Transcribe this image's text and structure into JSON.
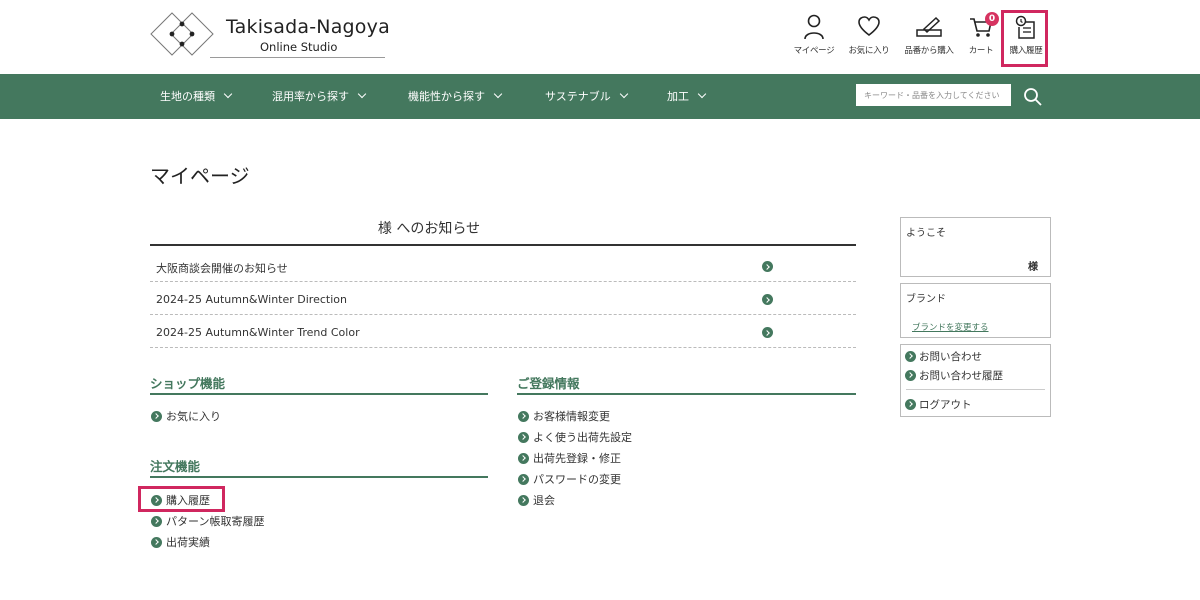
{
  "header": {
    "logo_title": "Takisada-Nagoya",
    "logo_subtitle": "Online Studio",
    "utility": [
      {
        "label": "マイページ",
        "icon": "person-icon"
      },
      {
        "label": "お気に入り",
        "icon": "heart-icon"
      },
      {
        "label": "品番から購入",
        "icon": "pencil-icon"
      },
      {
        "label": "カート",
        "icon": "cart-icon"
      },
      {
        "label": "購入履歴",
        "icon": "history-icon"
      }
    ],
    "cart_count": "0"
  },
  "nav": {
    "items": [
      {
        "label": "生地の種類"
      },
      {
        "label": "混用率から探す"
      },
      {
        "label": "機能性から探す"
      },
      {
        "label": "サステナブル"
      },
      {
        "label": "加工"
      }
    ],
    "search_placeholder": "キーワード・品番を入力してください"
  },
  "main": {
    "page_title": "マイページ",
    "notice_heading": "様 へのお知らせ",
    "notices": [
      {
        "text": "大阪商談会開催のお知らせ"
      },
      {
        "text": "2024-25 Autumn&Winter Direction"
      },
      {
        "text": "2024-25 Autumn&Winter Trend Color"
      }
    ],
    "shop": {
      "heading": "ショップ機能",
      "links": [
        {
          "label": "お気に入り"
        }
      ]
    },
    "order": {
      "heading": "注文機能",
      "links": [
        {
          "label": "購入履歴"
        },
        {
          "label": "パターン帳取寄履歴"
        },
        {
          "label": "出荷実績"
        }
      ]
    },
    "registration": {
      "heading": "ご登録情報",
      "links": [
        {
          "label": "お客様情報変更"
        },
        {
          "label": "よく使う出荷先設定"
        },
        {
          "label": "出荷先登録・修正"
        },
        {
          "label": "パスワードの変更"
        },
        {
          "label": "退会"
        }
      ]
    }
  },
  "sidebar": {
    "welcome_label": "ようこそ",
    "welcome_suffix": "様",
    "brand_label": "ブランド",
    "brand_change": "ブランドを変更する",
    "links": [
      {
        "label": "お問い合わせ"
      },
      {
        "label": "お問い合わせ履歴"
      },
      {
        "label": "ログアウト"
      }
    ]
  },
  "colors": {
    "brand_green": "#44785e",
    "highlight": "#d0275f",
    "badge": "#d63360"
  }
}
